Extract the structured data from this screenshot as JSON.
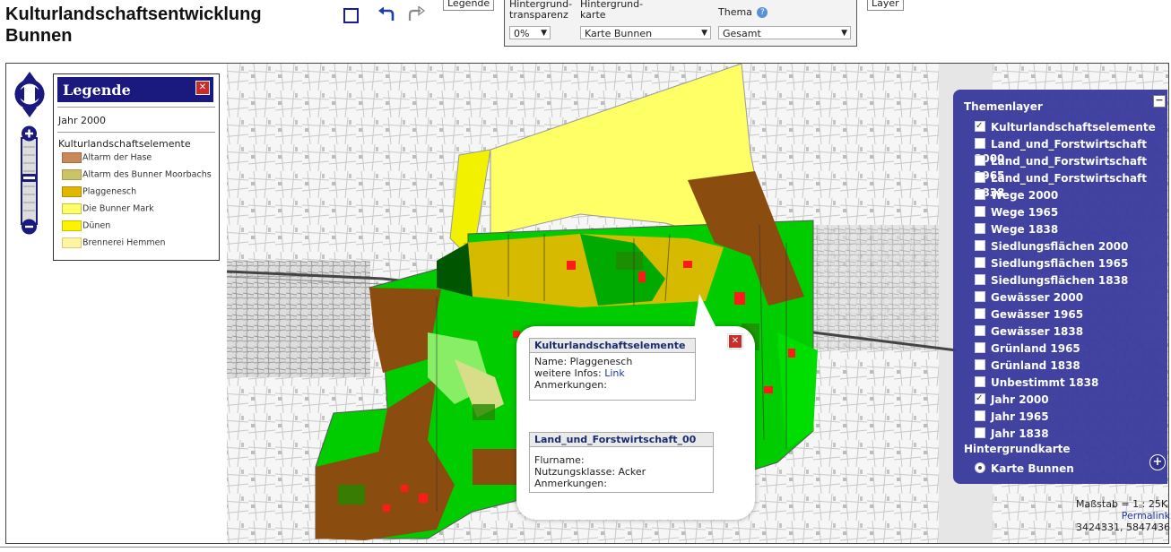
{
  "header": {
    "title_line1": "Kulturlandschaftsentwicklung",
    "title_line2": "Bunnen"
  },
  "toolbar": {
    "legend_button": "Legende",
    "layer_button": "Layer"
  },
  "controls": {
    "transparency_label_1": "Hintergrund-",
    "transparency_label_2": "transparenz",
    "transparency_value": "0%",
    "basemap_label_1": "Hintergrund-",
    "basemap_label_2": "karte",
    "basemap_value": "Karte Bunnen",
    "theme_label": "Thema",
    "theme_value": "Gesamt"
  },
  "legend": {
    "title": "Legende",
    "year": "Jahr 2000",
    "section": "Kulturlandschaftselemente",
    "items": [
      {
        "label": "Altarm der Hase",
        "color": "#c8885a"
      },
      {
        "label": "Altarm des Bunner Moorbachs",
        "color": "#c9c36a"
      },
      {
        "label": "Plaggenesch",
        "color": "#e0b800"
      },
      {
        "label": "Die Bunner Mark",
        "color": "#ffff66"
      },
      {
        "label": "Dünen",
        "color": "#fff200"
      },
      {
        "label": "Brennerei Hemmen",
        "color": "#fff5a0"
      }
    ]
  },
  "themes": {
    "header": "Themenlayer",
    "layers": [
      {
        "label": "Kulturlandschaftselemente",
        "checked": true
      },
      {
        "label": "Land_und_Forstwirtschaft 2000",
        "checked": false
      },
      {
        "label": "Land_und_Forstwirtschaft 1965",
        "checked": false
      },
      {
        "label": "Land_und_Forstwirtschaft 1838",
        "checked": false
      },
      {
        "label": "Wege 2000",
        "checked": false
      },
      {
        "label": "Wege 1965",
        "checked": false
      },
      {
        "label": "Wege 1838",
        "checked": false
      },
      {
        "label": "Siedlungsflächen 2000",
        "checked": false
      },
      {
        "label": "Siedlungsflächen 1965",
        "checked": false
      },
      {
        "label": "Siedlungsflächen 1838",
        "checked": false
      },
      {
        "label": "Gewässer 2000",
        "checked": false
      },
      {
        "label": "Gewässer 1965",
        "checked": false
      },
      {
        "label": "Gewässer 1838",
        "checked": false
      },
      {
        "label": "Grünland 1965",
        "checked": false
      },
      {
        "label": "Grünland 1838",
        "checked": false
      },
      {
        "label": "Unbestimmt 1838",
        "checked": false
      },
      {
        "label": "Jahr 2000",
        "checked": true
      },
      {
        "label": "Jahr 1965",
        "checked": false
      },
      {
        "label": "Jahr 1838",
        "checked": false
      }
    ],
    "background_header": "Hintergrundkarte",
    "background_option": "Karte Bunnen"
  },
  "popup": {
    "box1_title": "Kulturlandschaftselemente",
    "box1_name": "Name: Plaggenesch",
    "box1_info_prefix": "weitere Infos: ",
    "box1_info_link": "Link",
    "box1_notes": "Anmerkungen:",
    "box2_title": "Land_und_Forstwirtschaft_00",
    "box2_flurname": "Flurname:",
    "box2_class": "Nutzungsklasse: Acker",
    "box2_notes": "Anmerkungen:"
  },
  "status": {
    "scale": "Maßstab = 1 : 25K",
    "permalink": "Permalink",
    "coords": "3424331, 5847436"
  },
  "colors": {
    "accent": "#1a1a7e",
    "panel": "#3b3b9e",
    "close": "#cc2b2b",
    "link": "#2233aa"
  }
}
